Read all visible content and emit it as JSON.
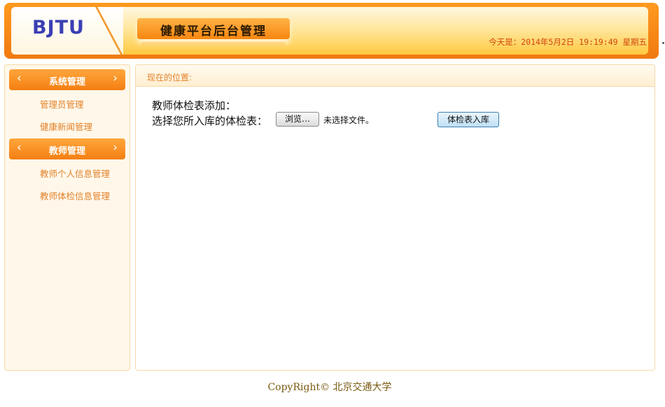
{
  "header": {
    "logo": "BJTU",
    "title": "健康平台后台管理",
    "datetime": "今天是：2014年5月2日 19:19:49 星期五"
  },
  "sidebar": {
    "groups": [
      {
        "label": "系统管理",
        "items": [
          {
            "label": "管理员管理"
          },
          {
            "label": "健康新闻管理"
          }
        ]
      },
      {
        "label": "教师管理",
        "items": [
          {
            "label": "教师个人信息管理"
          },
          {
            "label": "教师体检信息管理"
          }
        ]
      }
    ],
    "arrow_left": "‹",
    "arrow_right": "›"
  },
  "main": {
    "location_label": "现在的位置:",
    "form_title": "教师体检表添加：",
    "file_label": "选择您所入库的体检表：",
    "browse_label": "浏览…",
    "no_file_text": "未选择文件。",
    "submit_label": "体检表入库"
  },
  "footer": {
    "copyright": "CopyRight© 北京交通大学"
  },
  "colors": {
    "accent_orange": "#f47f12",
    "menu_text": "#e3822b",
    "logo_blue": "#3b3fb4",
    "datetime_red": "#d0440a"
  }
}
